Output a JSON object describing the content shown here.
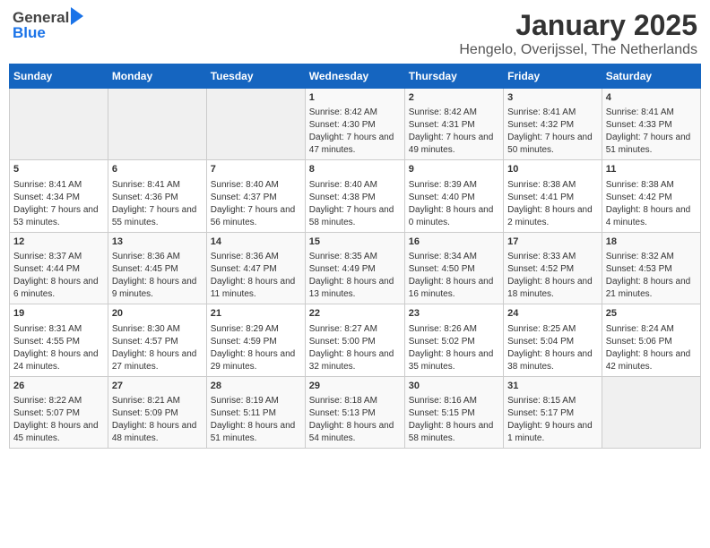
{
  "header": {
    "logo_general": "General",
    "logo_blue": "Blue",
    "month_title": "January 2025",
    "location": "Hengelo, Overijssel, The Netherlands"
  },
  "days_of_week": [
    "Sunday",
    "Monday",
    "Tuesday",
    "Wednesday",
    "Thursday",
    "Friday",
    "Saturday"
  ],
  "weeks": [
    [
      {
        "day": "",
        "content": ""
      },
      {
        "day": "",
        "content": ""
      },
      {
        "day": "",
        "content": ""
      },
      {
        "day": "1",
        "content": "Sunrise: 8:42 AM\nSunset: 4:30 PM\nDaylight: 7 hours and 47 minutes."
      },
      {
        "day": "2",
        "content": "Sunrise: 8:42 AM\nSunset: 4:31 PM\nDaylight: 7 hours and 49 minutes."
      },
      {
        "day": "3",
        "content": "Sunrise: 8:41 AM\nSunset: 4:32 PM\nDaylight: 7 hours and 50 minutes."
      },
      {
        "day": "4",
        "content": "Sunrise: 8:41 AM\nSunset: 4:33 PM\nDaylight: 7 hours and 51 minutes."
      }
    ],
    [
      {
        "day": "5",
        "content": "Sunrise: 8:41 AM\nSunset: 4:34 PM\nDaylight: 7 hours and 53 minutes."
      },
      {
        "day": "6",
        "content": "Sunrise: 8:41 AM\nSunset: 4:36 PM\nDaylight: 7 hours and 55 minutes."
      },
      {
        "day": "7",
        "content": "Sunrise: 8:40 AM\nSunset: 4:37 PM\nDaylight: 7 hours and 56 minutes."
      },
      {
        "day": "8",
        "content": "Sunrise: 8:40 AM\nSunset: 4:38 PM\nDaylight: 7 hours and 58 minutes."
      },
      {
        "day": "9",
        "content": "Sunrise: 8:39 AM\nSunset: 4:40 PM\nDaylight: 8 hours and 0 minutes."
      },
      {
        "day": "10",
        "content": "Sunrise: 8:38 AM\nSunset: 4:41 PM\nDaylight: 8 hours and 2 minutes."
      },
      {
        "day": "11",
        "content": "Sunrise: 8:38 AM\nSunset: 4:42 PM\nDaylight: 8 hours and 4 minutes."
      }
    ],
    [
      {
        "day": "12",
        "content": "Sunrise: 8:37 AM\nSunset: 4:44 PM\nDaylight: 8 hours and 6 minutes."
      },
      {
        "day": "13",
        "content": "Sunrise: 8:36 AM\nSunset: 4:45 PM\nDaylight: 8 hours and 9 minutes."
      },
      {
        "day": "14",
        "content": "Sunrise: 8:36 AM\nSunset: 4:47 PM\nDaylight: 8 hours and 11 minutes."
      },
      {
        "day": "15",
        "content": "Sunrise: 8:35 AM\nSunset: 4:49 PM\nDaylight: 8 hours and 13 minutes."
      },
      {
        "day": "16",
        "content": "Sunrise: 8:34 AM\nSunset: 4:50 PM\nDaylight: 8 hours and 16 minutes."
      },
      {
        "day": "17",
        "content": "Sunrise: 8:33 AM\nSunset: 4:52 PM\nDaylight: 8 hours and 18 minutes."
      },
      {
        "day": "18",
        "content": "Sunrise: 8:32 AM\nSunset: 4:53 PM\nDaylight: 8 hours and 21 minutes."
      }
    ],
    [
      {
        "day": "19",
        "content": "Sunrise: 8:31 AM\nSunset: 4:55 PM\nDaylight: 8 hours and 24 minutes."
      },
      {
        "day": "20",
        "content": "Sunrise: 8:30 AM\nSunset: 4:57 PM\nDaylight: 8 hours and 27 minutes."
      },
      {
        "day": "21",
        "content": "Sunrise: 8:29 AM\nSunset: 4:59 PM\nDaylight: 8 hours and 29 minutes."
      },
      {
        "day": "22",
        "content": "Sunrise: 8:27 AM\nSunset: 5:00 PM\nDaylight: 8 hours and 32 minutes."
      },
      {
        "day": "23",
        "content": "Sunrise: 8:26 AM\nSunset: 5:02 PM\nDaylight: 8 hours and 35 minutes."
      },
      {
        "day": "24",
        "content": "Sunrise: 8:25 AM\nSunset: 5:04 PM\nDaylight: 8 hours and 38 minutes."
      },
      {
        "day": "25",
        "content": "Sunrise: 8:24 AM\nSunset: 5:06 PM\nDaylight: 8 hours and 42 minutes."
      }
    ],
    [
      {
        "day": "26",
        "content": "Sunrise: 8:22 AM\nSunset: 5:07 PM\nDaylight: 8 hours and 45 minutes."
      },
      {
        "day": "27",
        "content": "Sunrise: 8:21 AM\nSunset: 5:09 PM\nDaylight: 8 hours and 48 minutes."
      },
      {
        "day": "28",
        "content": "Sunrise: 8:19 AM\nSunset: 5:11 PM\nDaylight: 8 hours and 51 minutes."
      },
      {
        "day": "29",
        "content": "Sunrise: 8:18 AM\nSunset: 5:13 PM\nDaylight: 8 hours and 54 minutes."
      },
      {
        "day": "30",
        "content": "Sunrise: 8:16 AM\nSunset: 5:15 PM\nDaylight: 8 hours and 58 minutes."
      },
      {
        "day": "31",
        "content": "Sunrise: 8:15 AM\nSunset: 5:17 PM\nDaylight: 9 hours and 1 minute."
      },
      {
        "day": "",
        "content": ""
      }
    ]
  ]
}
